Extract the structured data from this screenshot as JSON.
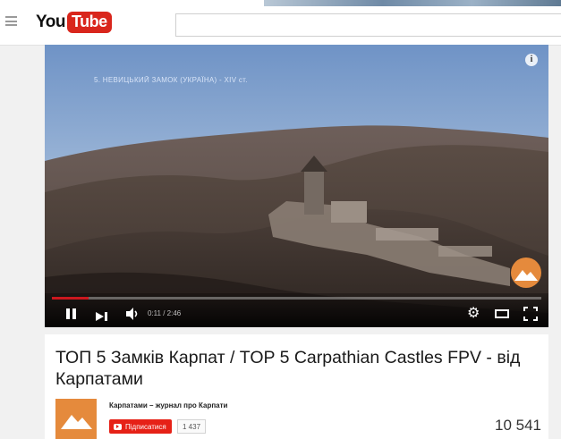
{
  "masthead": {
    "logo_you": "You",
    "logo_tube": "Tube",
    "search_placeholder": ""
  },
  "player": {
    "overlay_caption": "5. НЕВИЦЬКИЙ ЗАМОК (УКРАЇНА) - XIV ст.",
    "time_display": "0:11 / 2:46",
    "progress_fraction": 0.075,
    "info_icon": "i",
    "icons": [
      "pause-icon",
      "next-icon",
      "volume-icon",
      "gear-icon",
      "theater-icon",
      "fullscreen-icon",
      "info-icon"
    ]
  },
  "video": {
    "title": "ТОП 5 Замків Карпат / TOP 5 Carpathian Castles FPV - від Карпатами",
    "channel_name": "Карпатами – журнал про Карпати",
    "subscribe_label": "Підписатися",
    "subscriber_count": "1 437",
    "view_count": "10 541"
  },
  "colors": {
    "brand_red": "#d9261c",
    "subscribe_red": "#e62117",
    "channel_orange": "#e58a3c"
  }
}
